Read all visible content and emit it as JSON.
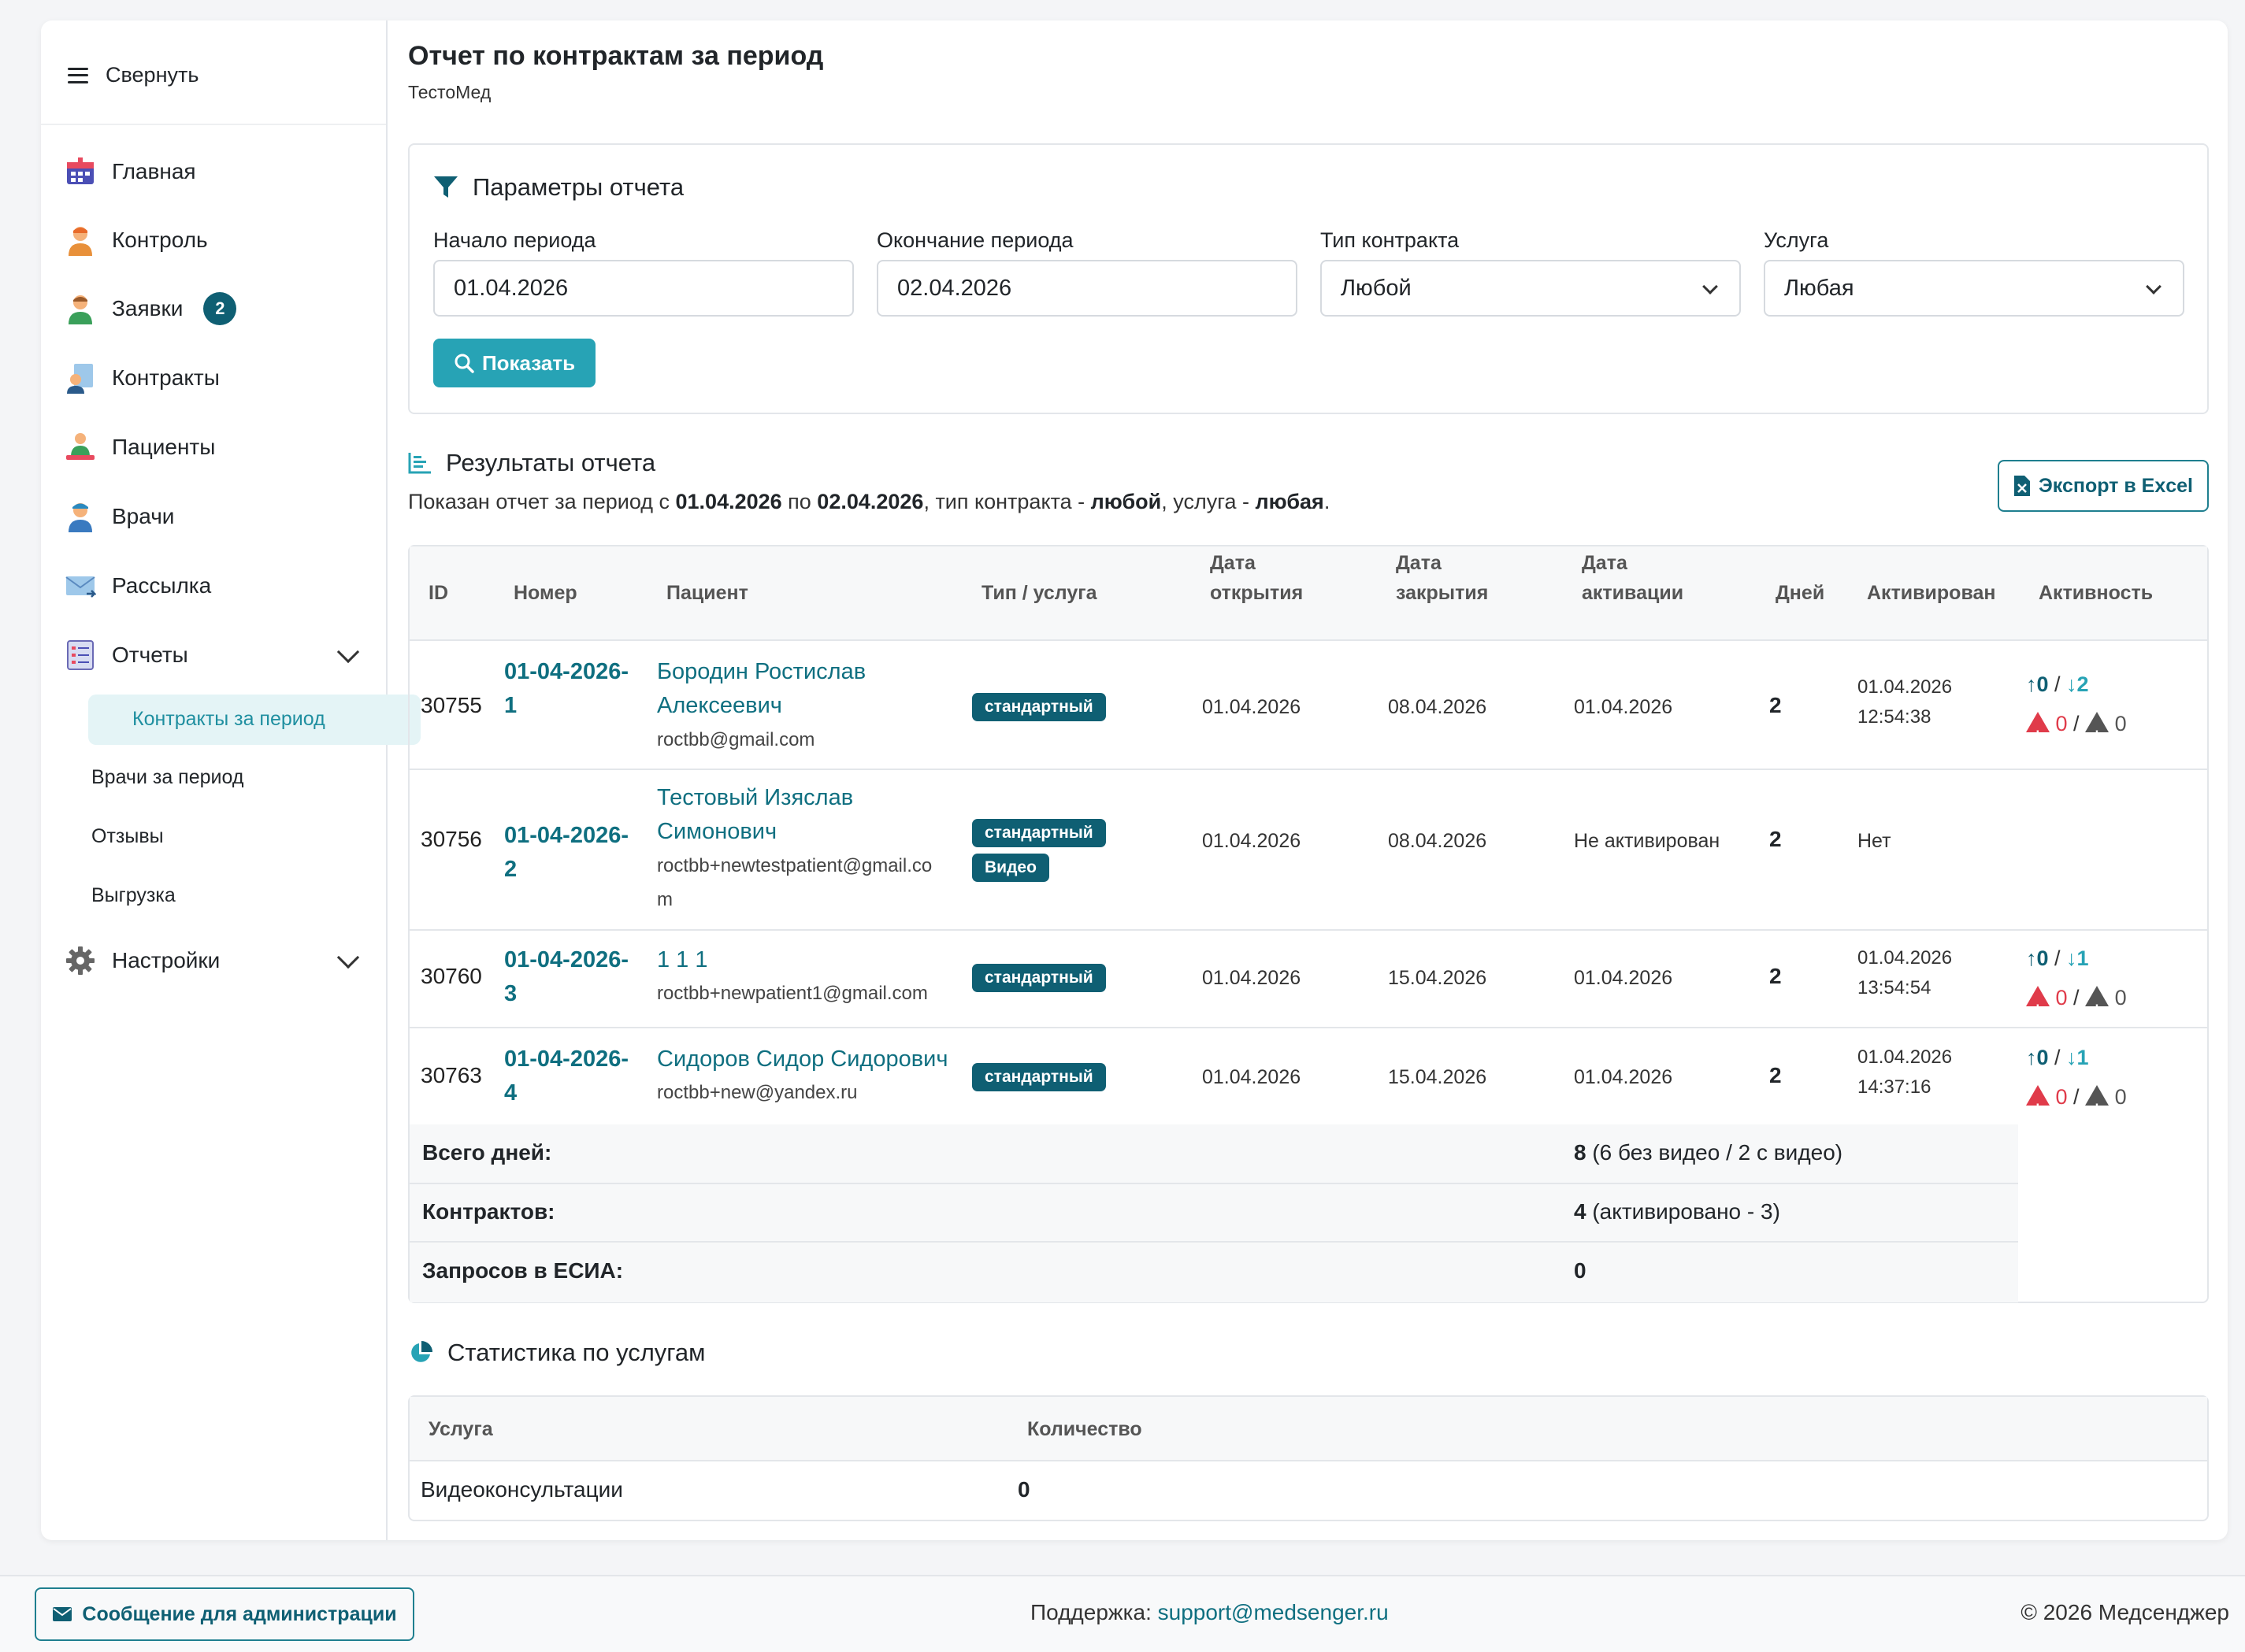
{
  "sidebar": {
    "collapse_label": "Свернуть",
    "items": [
      {
        "label": "Главная",
        "icon": "grid-calendar-icon"
      },
      {
        "label": "Контроль",
        "icon": "person-orange-icon"
      },
      {
        "label": "Заявки",
        "icon": "person-green-icon",
        "badge": "2"
      },
      {
        "label": "Контракты",
        "icon": "document-person-icon"
      },
      {
        "label": "Пациенты",
        "icon": "patients-icon"
      },
      {
        "label": "Врачи",
        "icon": "doctor-icon"
      },
      {
        "label": "Рассылка",
        "icon": "envelope-icon"
      },
      {
        "label": "Отчеты",
        "icon": "checklist-icon"
      },
      {
        "label": "Настройки",
        "icon": "gear-icon"
      }
    ],
    "reports_sub": [
      "Контракты за период",
      "Врачи за период",
      "Отзывы",
      "Выгрузка"
    ]
  },
  "header": {
    "title": "Отчет по контрактам за период",
    "subtitle": "ТестоМед"
  },
  "params": {
    "title": "Параметры отчета",
    "start_label": "Начало периода",
    "start_value": "01.04.2026",
    "end_label": "Окончание периода",
    "end_value": "02.04.2026",
    "type_label": "Тип контракта",
    "type_value": "Любой",
    "service_label": "Услуга",
    "service_value": "Любая",
    "show_button": "Показать"
  },
  "results": {
    "title": "Результаты отчета",
    "desc_prefix": "Показан отчет за период с ",
    "desc_from": "01.04.2026",
    "desc_mid": " по ",
    "desc_to": "02.04.2026",
    "desc_type_prefix": ", тип контракта - ",
    "desc_type": "любой",
    "desc_service_prefix": ", услуга - ",
    "desc_service": "любая",
    "desc_end": ".",
    "export_button": "Экспорт в Excel",
    "columns": [
      "ID",
      "Номер",
      "Пациент",
      "Тип / услуга",
      "Дата",
      "открытия",
      "Дата",
      "закрытия",
      "Дата",
      "активации",
      "Дней",
      "Активирован",
      "Активность"
    ],
    "rows": [
      {
        "id": "30755",
        "num1": "01-04-2026-",
        "num2": "1",
        "name1": "Бородин Ростислав",
        "name2": "Алексеевич",
        "email1": "roctbb@gmail.com",
        "email2": "",
        "tags": [
          "стандартный"
        ],
        "open": "01.04.2026",
        "close": "08.04.2026",
        "activation": "01.04.2026",
        "days": "2",
        "activated1": "01.04.2026",
        "activated2": "12:54:38",
        "up": "0",
        "down": "2",
        "red": "0",
        "gray": "0"
      },
      {
        "id": "30756",
        "num1": "01-04-2026-",
        "num2": "2",
        "name1": "Тестовый Изяслав",
        "name2": "Симонович",
        "email1": "roctbb+newtestpatient@gmail.co",
        "email2": "m",
        "tags": [
          "стандартный",
          "Видео"
        ],
        "open": "01.04.2026",
        "close": "08.04.2026",
        "activation": "Не активирован",
        "days": "2",
        "activated1": "Нет",
        "activated2": "",
        "up": "",
        "down": "",
        "red": "",
        "gray": ""
      },
      {
        "id": "30760",
        "num1": "01-04-2026-",
        "num2": "3",
        "name1": "1 1 1",
        "name2": "",
        "email1": "roctbb+newpatient1@gmail.com",
        "email2": "",
        "tags": [
          "стандартный"
        ],
        "open": "01.04.2026",
        "close": "15.04.2026",
        "activation": "01.04.2026",
        "days": "2",
        "activated1": "01.04.2026",
        "activated2": "13:54:54",
        "up": "0",
        "down": "1",
        "red": "0",
        "gray": "0"
      },
      {
        "id": "30763",
        "num1": "01-04-2026-",
        "num2": "4",
        "name1": "Сидоров Сидор Сидорович",
        "name2": "",
        "email1": "roctbb+new@yandex.ru",
        "email2": "",
        "tags": [
          "стандартный"
        ],
        "open": "01.04.2026",
        "close": "15.04.2026",
        "activation": "01.04.2026",
        "days": "2",
        "activated1": "01.04.2026",
        "activated2": "14:37:16",
        "up": "0",
        "down": "1",
        "red": "0",
        "gray": "0"
      }
    ],
    "summary": [
      {
        "label": "Всего дней:",
        "bold": "8",
        "rest": " (6 без видео / 2 с видео)"
      },
      {
        "label": "Контрактов:",
        "bold": "4",
        "rest": " (активировано - 3)"
      },
      {
        "label": "Запросов в ЕСИА:",
        "bold": "0",
        "rest": ""
      }
    ]
  },
  "stats": {
    "title": "Статистика по услугам",
    "columns": [
      "Услуга",
      "Количество"
    ],
    "rows": [
      {
        "service": "Видеоконсультации",
        "count": "0"
      }
    ]
  },
  "footer": {
    "admin_button": "Сообщение для администрации",
    "support_label": "Поддержка: ",
    "support_email": "support@medsenger.ru",
    "copyright": "© 2026 Медсенджер"
  },
  "colors": {
    "accent": "#27a3b5",
    "dark_teal": "#0f5f73",
    "link": "#0f6f80",
    "danger": "#e03b4a"
  }
}
